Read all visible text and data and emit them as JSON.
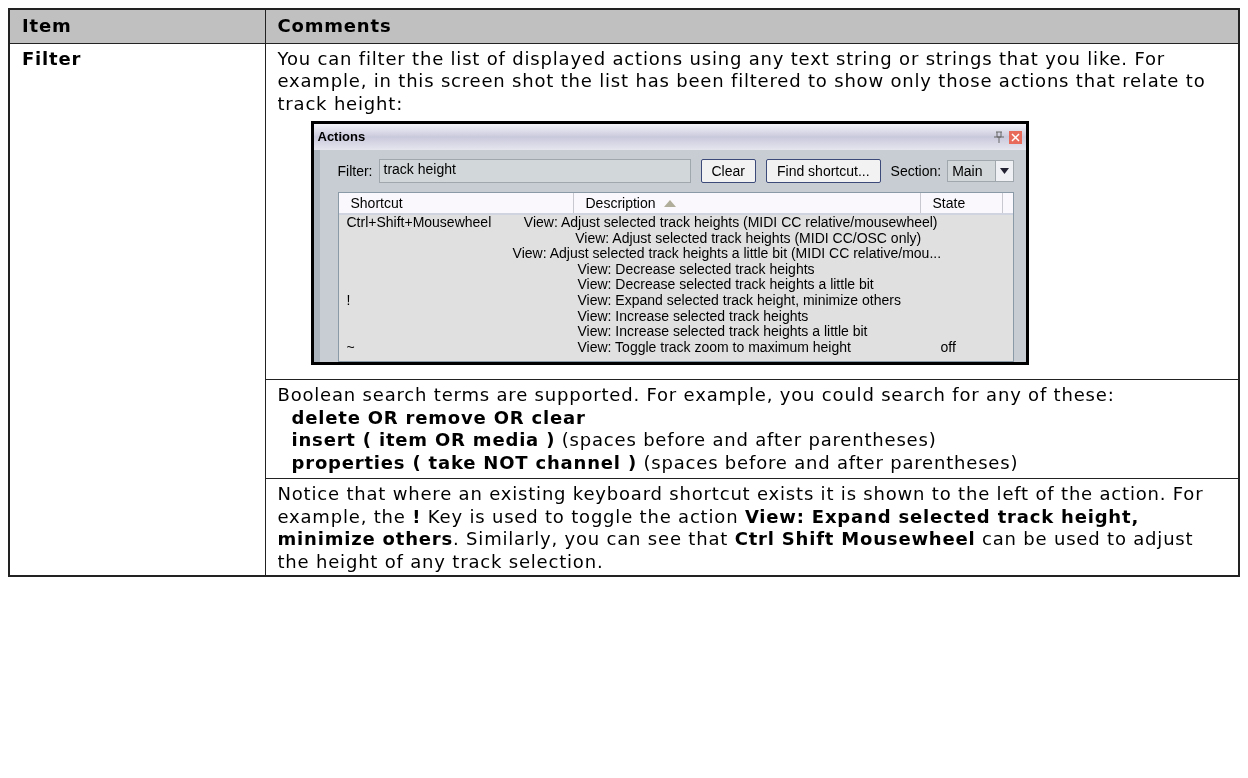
{
  "table": {
    "columns": [
      "Item",
      "Comments"
    ],
    "rows": [
      {
        "item": "Filter",
        "intro": "You can filter the list of displayed actions using any text string or strings that you like. For example, in this screen shot the list has been filtered to show only those actions that relate to track height:",
        "screenshot": {
          "title": "Actions",
          "filter_label": "Filter:",
          "filter_value": "track height",
          "buttons": [
            "Clear",
            "Find shortcut..."
          ],
          "section_label": "Section:",
          "section_value": "Main",
          "columns": [
            {
              "label": "Shortcut",
              "sorted": false
            },
            {
              "label": "Description",
              "sorted": true
            },
            {
              "label": "State",
              "sorted": false
            }
          ],
          "rows": [
            {
              "shortcut": "Ctrl+Shift+Mousewheel",
              "description": "View: Adjust selected track heights (MIDI CC relative/mousewheel)"
            },
            {
              "description": "View: Adjust selected track heights (MIDI CC/OSC only)"
            },
            {
              "description": "View: Adjust selected track heights a little bit (MIDI CC relative/mou..."
            },
            {
              "description": "View: Decrease selected track heights"
            },
            {
              "description": "View: Decrease selected track heights a little bit"
            },
            {
              "shortcut": "!",
              "description": "View: Expand selected track height, minimize others"
            },
            {
              "description": "View: Increase selected track heights"
            },
            {
              "description": "View: Increase selected track heights a little bit"
            },
            {
              "shortcut": "~",
              "description": "View: Toggle track zoom to maximum height",
              "state": "off"
            }
          ]
        },
        "boolean_intro": "Boolean search terms are supported. For example, you could search for any of these:",
        "examples": [
          "**delete OR remove OR clear**",
          "**insert ( item OR media )** (spaces before and after parentheses)",
          "**properties ( take NOT channel )** (spaces before and after parentheses)"
        ],
        "notice": "Notice that where an existing keyboard shortcut exists it is shown to the left of the action. For example, the **!** Key is used to toggle the action **View: Expand selected track height, minimize others**. Similarly, you can see that **Ctrl Shift Mousewheel** can be used to adjust the height of any track selection."
      }
    ]
  }
}
